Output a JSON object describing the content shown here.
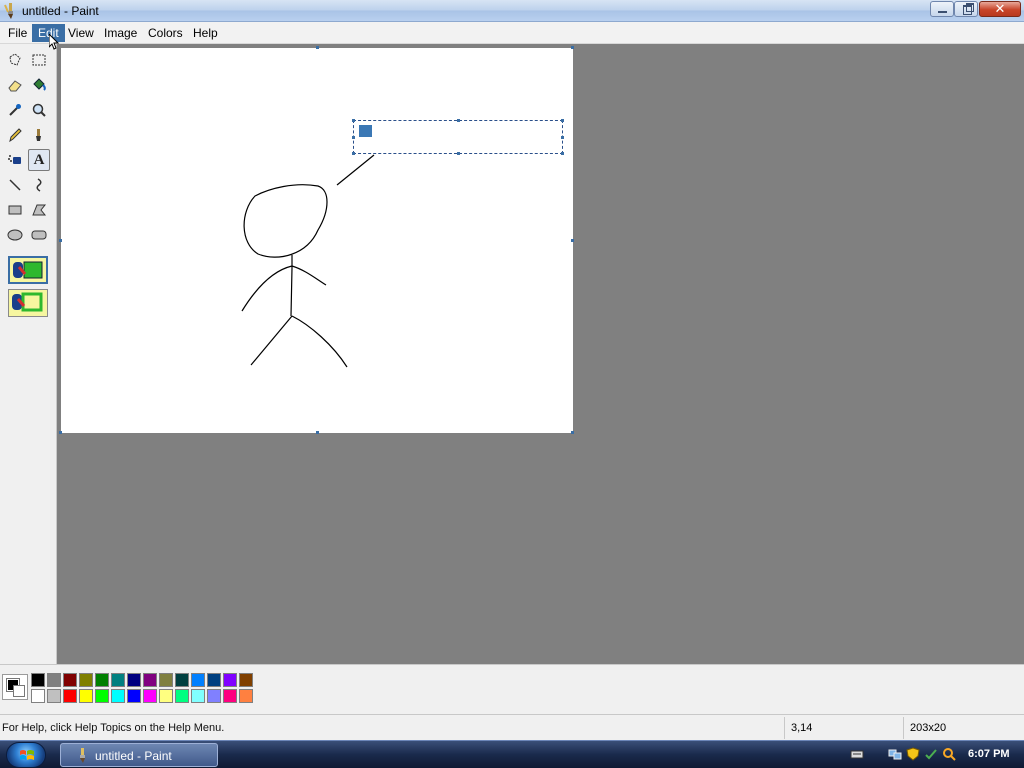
{
  "window": {
    "title": "untitled - Paint",
    "icon": "paint-brush-icon"
  },
  "menu": {
    "items": [
      "File",
      "Edit",
      "View",
      "Image",
      "Colors",
      "Help"
    ],
    "active": "Edit"
  },
  "tools": [
    {
      "name": "free-form-select",
      "icon": "free-form-select-icon"
    },
    {
      "name": "select",
      "icon": "rect-select-icon"
    },
    {
      "name": "eraser",
      "icon": "eraser-icon"
    },
    {
      "name": "fill-with-color",
      "icon": "paint-bucket-icon"
    },
    {
      "name": "pick-color",
      "icon": "eyedropper-icon"
    },
    {
      "name": "magnifier",
      "icon": "magnifier-icon"
    },
    {
      "name": "pencil",
      "icon": "pencil-icon"
    },
    {
      "name": "brush",
      "icon": "brush-icon"
    },
    {
      "name": "airbrush",
      "icon": "airbrush-icon"
    },
    {
      "name": "text",
      "icon": "text-icon",
      "label": "A",
      "selected": true
    },
    {
      "name": "line",
      "icon": "line-icon"
    },
    {
      "name": "curve",
      "icon": "curve-icon"
    },
    {
      "name": "rectangle",
      "icon": "rectangle-icon"
    },
    {
      "name": "polygon",
      "icon": "polygon-icon"
    },
    {
      "name": "ellipse",
      "icon": "ellipse-icon"
    },
    {
      "name": "rounded-rectangle",
      "icon": "rounded-rect-icon"
    }
  ],
  "tool_options": [
    {
      "name": "opaque-background",
      "selected": true
    },
    {
      "name": "transparent-background",
      "selected": false
    }
  ],
  "palette": {
    "foreground": "#000000",
    "background": "#ffffff",
    "row1": [
      "#000000",
      "#808080",
      "#800000",
      "#808000",
      "#008000",
      "#008080",
      "#000080",
      "#800080",
      "#808040",
      "#004040",
      "#0080ff",
      "#004080",
      "#8000ff",
      "#804000"
    ],
    "row2": [
      "#ffffff",
      "#c0c0c0",
      "#ff0000",
      "#ffff00",
      "#00ff00",
      "#00ffff",
      "#0000ff",
      "#ff00ff",
      "#ffff80",
      "#00ff80",
      "#80ffff",
      "#8080ff",
      "#ff0080",
      "#ff8040"
    ]
  },
  "status": {
    "help": "For Help, click Help Topics on the Help Menu.",
    "coords": "3,14",
    "size": "203x20"
  },
  "taskbar": {
    "task_label": "untitled - Paint",
    "clock": "6:07 PM"
  }
}
